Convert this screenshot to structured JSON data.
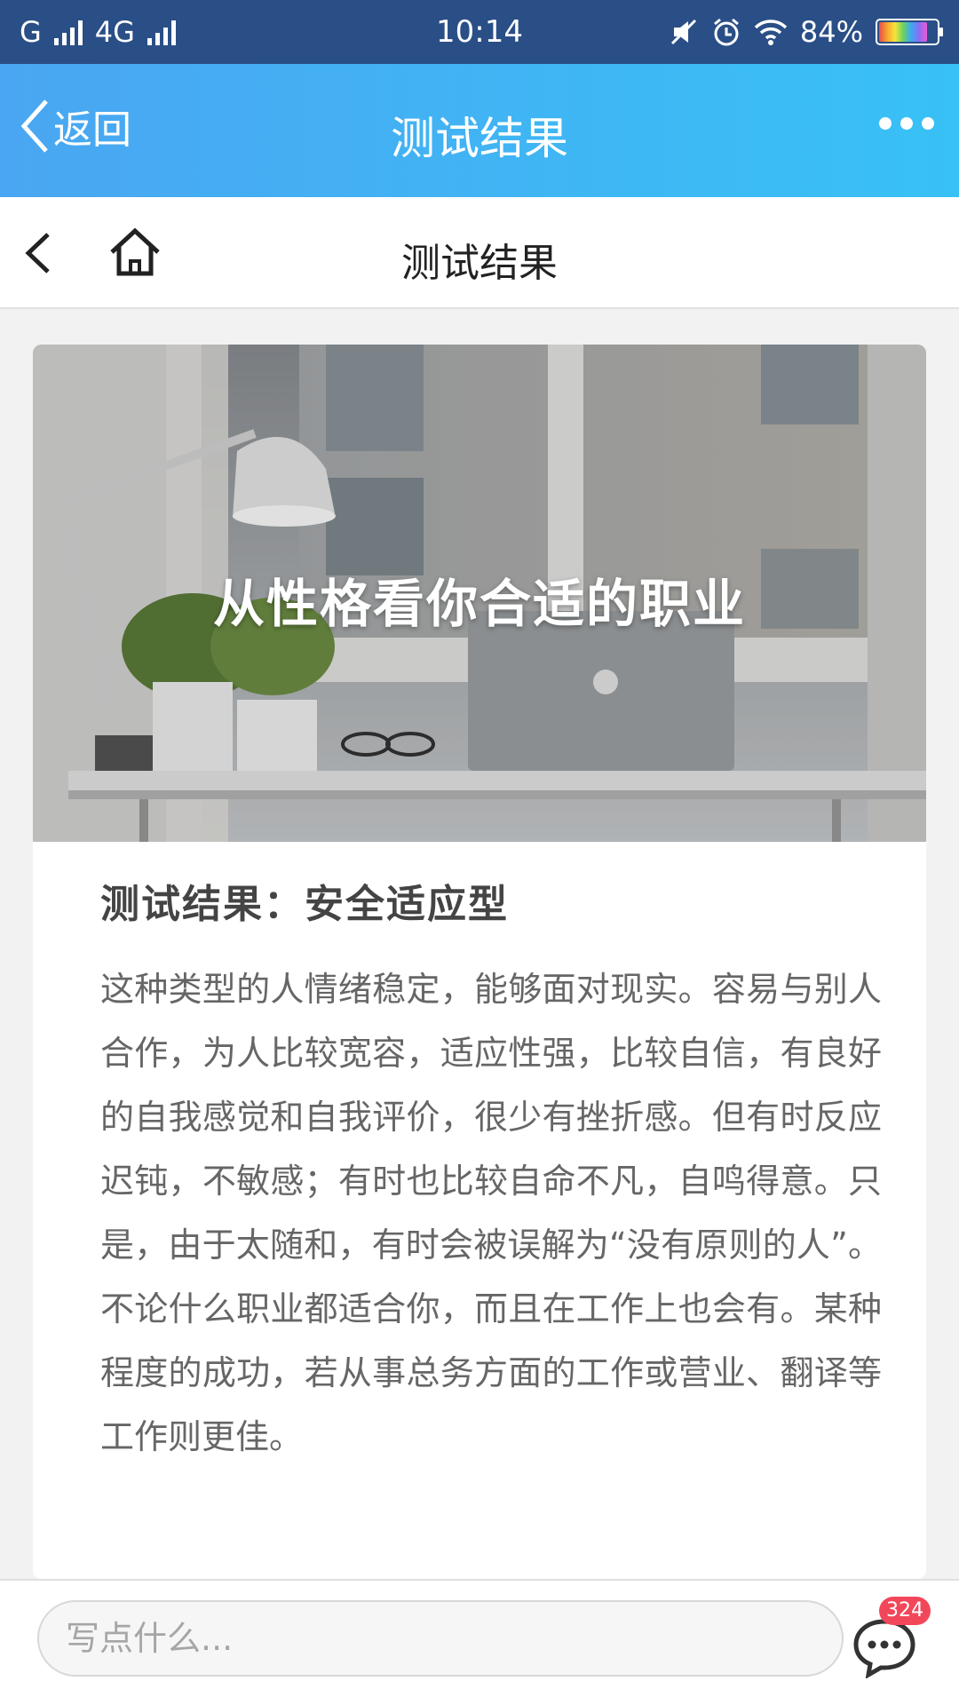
{
  "status_bar": {
    "carrier_label": "G",
    "network_label": "4G",
    "time": "10:14",
    "battery_percent": "84%",
    "battery_level": 0.84,
    "icons": [
      "signal-icon",
      "mute-icon",
      "alarm-icon",
      "wifi-icon",
      "battery-icon"
    ]
  },
  "title_bar": {
    "back_label": "返回",
    "title": "测试结果",
    "more_icon": "more-dots-icon",
    "colors": {
      "gradient_start": "#4aa6f2",
      "gradient_end": "#38c1f5"
    }
  },
  "sub_header": {
    "title": "测试结果",
    "back_icon": "chevron-left-icon",
    "home_icon": "home-icon"
  },
  "card": {
    "hero_title": "从性格看你合适的职业",
    "result_heading": "测试结果：安全适应型",
    "result_body": "这种类型的人情绪稳定，能够面对现实。容易与别人合作，为人比较宽容，适应性强，比较自信，有良好的自我感觉和自我评价，很少有挫折感。但有时反应迟钝，不敏感；有时也比较自命不凡，自鸣得意。只是，由于太随和，有时会被误解为“没有原则的人”。 不论什么职业都适合你，而且在工作上也会有。某种程度的成功，若从事总务方面的工作或营业、翻译等工作则更佳。"
  },
  "bottom_bar": {
    "input_placeholder": "写点什么...",
    "chat_icon": "chat-bubble-icon",
    "badge_count": "324",
    "badge_color": "#f2475a"
  }
}
